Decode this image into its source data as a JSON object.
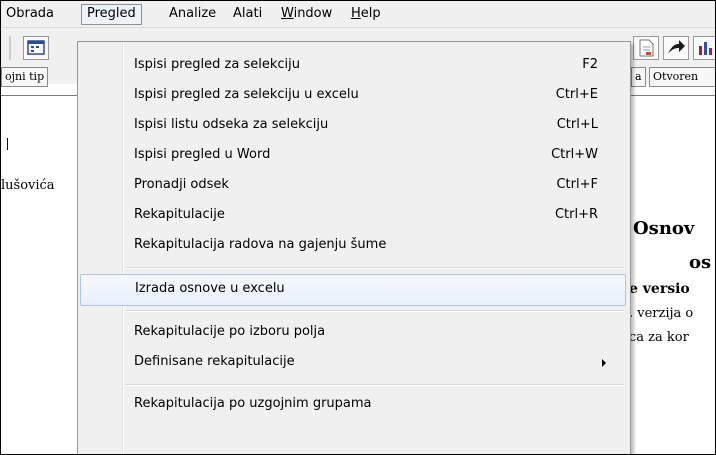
{
  "menubar": {
    "items": [
      "Obrada",
      "Pregled",
      "Analize",
      "Alati",
      "Window",
      "Help"
    ]
  },
  "tabs": {
    "left": "ojni tip",
    "right1": "a",
    "right2": "Otvoren"
  },
  "document": {
    "left_text": "lušovića",
    "heading1": "Osnov",
    "heading2": "os",
    "line1": "e versio",
    "line2": ". verzija o",
    "line3": "ca za kor"
  },
  "menu": {
    "items": [
      {
        "label": "Ispisi pregled za selekciju",
        "shortcut": "F2"
      },
      {
        "label": "Ispisi pregled za selekciju u excelu",
        "shortcut": "Ctrl+E"
      },
      {
        "label": "Ispisi listu odseka za selekciju",
        "shortcut": "Ctrl+L"
      },
      {
        "label": "Ispisi pregled u Word",
        "shortcut": "Ctrl+W"
      },
      {
        "label": "Pronadji odsek",
        "shortcut": "Ctrl+F"
      },
      {
        "label": "Rekapitulacije",
        "shortcut": "Ctrl+R"
      },
      {
        "label": "Rekapitulacija radova na gajenju šume",
        "shortcut": ""
      },
      {
        "label": "Izrada osnove u excelu",
        "shortcut": ""
      },
      {
        "label": "Rekapitulacije po izboru polja",
        "shortcut": ""
      },
      {
        "label": "Definisane rekapitulacije",
        "shortcut": ""
      },
      {
        "label": "Rekapitulacija po uzgojnim grupama",
        "shortcut": ""
      }
    ]
  }
}
